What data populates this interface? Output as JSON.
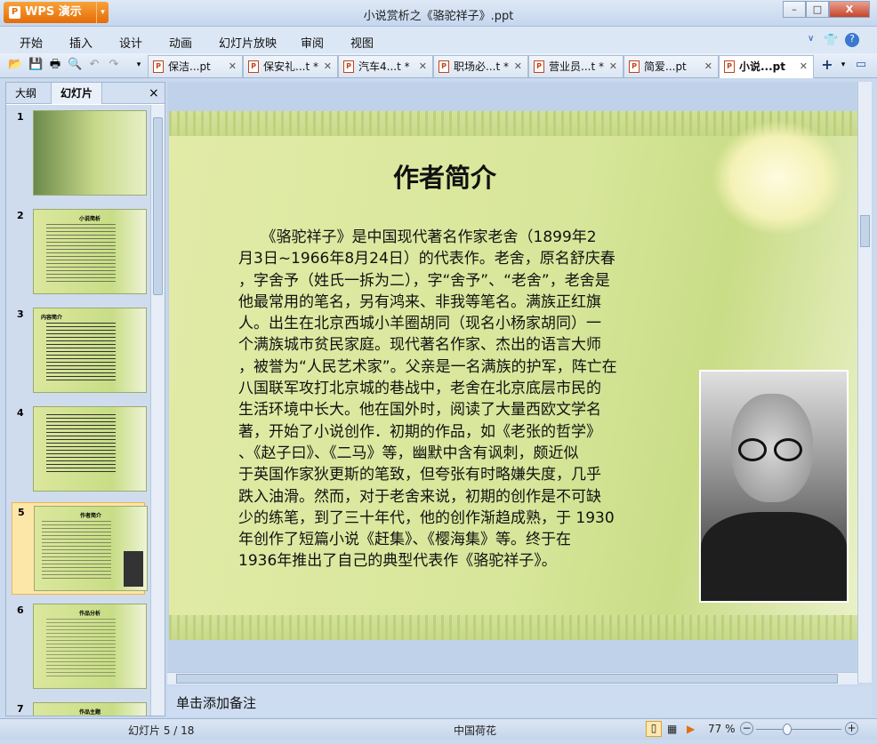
{
  "app": {
    "logo": "WPS 演示",
    "title": "小说赏析之《骆驼祥子》.ppt",
    "minimize": "–",
    "maximize": "□",
    "close": "X"
  },
  "menu": [
    "开始",
    "插入",
    "设计",
    "动画",
    "幻灯片放映",
    "审阅",
    "视图"
  ],
  "doc_tabs": [
    {
      "label": "保洁...pt",
      "active": false
    },
    {
      "label": "保安礼...t *",
      "active": false
    },
    {
      "label": "汽车4...t *",
      "active": false
    },
    {
      "label": "职场必...t *",
      "active": false
    },
    {
      "label": "营业员...t *",
      "active": false
    },
    {
      "label": "简爱...pt",
      "active": false
    },
    {
      "label": "小说...pt",
      "active": true
    }
  ],
  "left_panel": {
    "tabs": [
      "大纲",
      "幻灯片"
    ],
    "active_tab": "幻灯片",
    "close": "×",
    "thumbnails": [
      {
        "num": "1",
        "title": ""
      },
      {
        "num": "2",
        "title": "小说简析"
      },
      {
        "num": "3",
        "title": "内容简介"
      },
      {
        "num": "4",
        "title": ""
      },
      {
        "num": "5",
        "title": "作者简介"
      },
      {
        "num": "6",
        "title": "作品分析"
      },
      {
        "num": "7",
        "title": "作品主题"
      }
    ],
    "selected": 5
  },
  "slide": {
    "title": "作者简介",
    "body_lines": [
      "　　《骆驼祥子》是中国现代著名作家老舍（1899年2",
      "月3日~1966年8月24日）的代表作。老舍，原名舒庆春",
      "，字舍予（姓氏一拆为二），字“舍予”、“老舍”，老舍是",
      "他最常用的笔名，另有鸿来、非我等笔名。满族正红旗",
      "人。出生在北京西城小羊圈胡同（现名小杨家胡同）一",
      "个满族城市贫民家庭。现代著名作家、杰出的语言大师",
      "，被誉为“人民艺术家”。父亲是一名满族的护军，阵亡在",
      "八国联军攻打北京城的巷战中，老舍在北京底层市民的",
      "生活环境中长大。他在国外时，阅读了大量西欧文学名",
      "著，开始了小说创作．初期的作品，如《老张的哲学》",
      "、《赵子曰》、《二马》等，幽默中含有讽刺，颇近似",
      "于英国作家狄更斯的笔致，但夸张有时略嫌失度，几乎",
      "跌入油滑。然而，对于老舍来说，初期的创作是不可缺",
      "少的练笔，到了三十年代，他的创作渐趋成熟，于 1930",
      "年创作了短篇小说《赶集》、《樱海集》等。终于在",
      "1936年推出了自己的典型代表作《骆驼祥子》。"
    ]
  },
  "notes_placeholder": "单击添加备注",
  "status": {
    "slide_counter": "幻灯片 5 / 18",
    "theme": "中国荷花",
    "zoom": "77 %",
    "zoom_level_percent": 77
  }
}
